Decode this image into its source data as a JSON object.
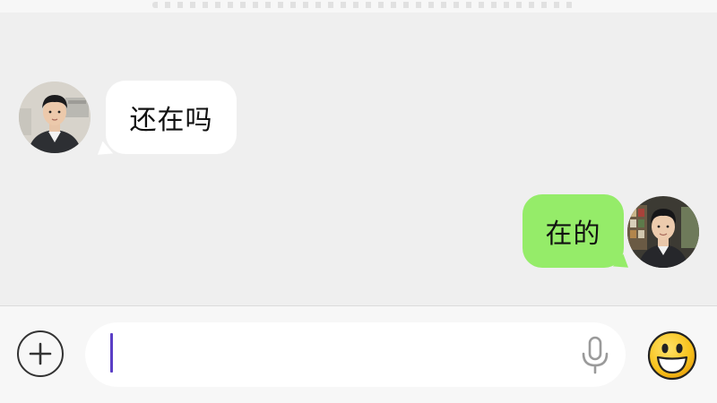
{
  "chat": {
    "messages": [
      {
        "direction": "incoming",
        "text": "还在吗",
        "avatar_icon": "contact-avatar-photo",
        "bubble_color": "#ffffff"
      },
      {
        "direction": "outgoing",
        "text": "在的",
        "avatar_icon": "self-avatar-photo",
        "bubble_color": "#95ec69"
      }
    ],
    "background_color": "#efefef"
  },
  "input_bar": {
    "plus_icon": "plus-circle-icon",
    "text_value": "",
    "mic_icon": "microphone-icon",
    "emoji_icon": "smiley-emoji-icon",
    "caret_color": "#5b3fc6"
  }
}
